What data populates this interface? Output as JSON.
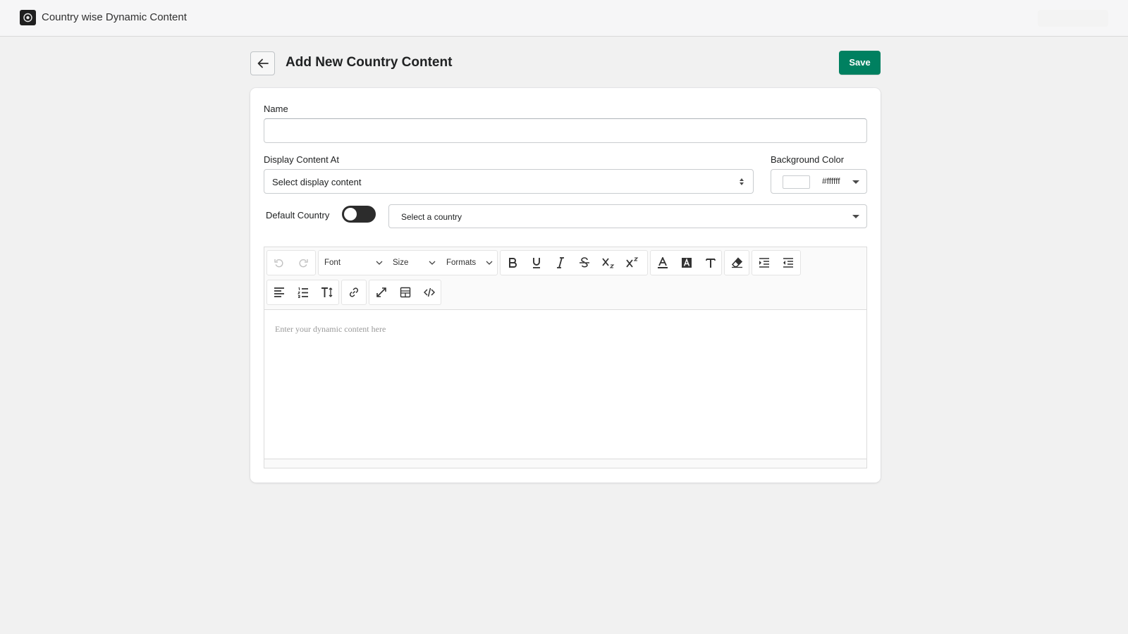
{
  "app": {
    "title": "Country wise Dynamic Content"
  },
  "header": {
    "title": "Add New Country Content",
    "save_label": "Save"
  },
  "form": {
    "name": {
      "label": "Name",
      "value": ""
    },
    "display_content": {
      "label": "Display Content At",
      "placeholder": "Select display content"
    },
    "background_color": {
      "label": "Background Color",
      "value": "#ffffff"
    },
    "default_country": {
      "label": "Default Country",
      "enabled": false
    },
    "country": {
      "placeholder": "Select a country"
    }
  },
  "editor": {
    "font_label": "Font",
    "size_label": "Size",
    "formats_label": "Formats",
    "placeholder": "Enter your dynamic content here",
    "toolbar_row1": [
      "undo-icon",
      "redo-icon",
      "font-dropdown",
      "size-dropdown",
      "formats-dropdown",
      "bold-icon",
      "underline-icon",
      "italic-icon",
      "strikethrough-icon",
      "subscript-icon",
      "superscript-icon",
      "font-color-icon",
      "background-color-icon",
      "clear-format-icon",
      "eraser-icon",
      "indent-icon",
      "outdent-icon"
    ],
    "toolbar_row2": [
      "align-left-icon",
      "ordered-list-icon",
      "line-height-icon",
      "link-icon",
      "fullscreen-icon",
      "template-icon",
      "code-view-icon"
    ]
  },
  "colors": {
    "accent": "#008060",
    "toggle_off": "#2c2c2c"
  }
}
